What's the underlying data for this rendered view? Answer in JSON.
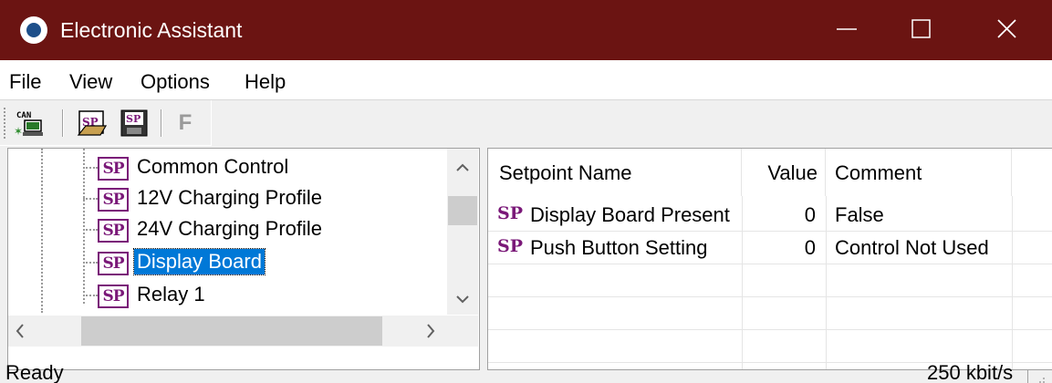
{
  "window": {
    "title": "Electronic Assistant",
    "title_bar_color": "#6b1412",
    "controls": [
      "minimize-icon",
      "maximize-icon",
      "close-icon"
    ]
  },
  "menu": {
    "items": [
      "File",
      "View",
      "Options",
      "Help"
    ]
  },
  "toolbar": {
    "can_label": "CAN",
    "sp_label": "SP",
    "f_label": "F",
    "buttons": [
      "can-connect-icon",
      "sp-open-icon",
      "sp-save-icon",
      "f-icon"
    ]
  },
  "tree": {
    "icon_text": "SP",
    "items": [
      {
        "label": "Common Control",
        "selected": false
      },
      {
        "label": "12V Charging Profile",
        "selected": false
      },
      {
        "label": "24V Charging Profile",
        "selected": false
      },
      {
        "label": "Display Board",
        "selected": true
      },
      {
        "label": "Relay 1",
        "selected": false
      }
    ],
    "selection_color": "#0078d7"
  },
  "list": {
    "columns": [
      "Setpoint Name",
      "Value",
      "Comment"
    ],
    "sp_prefix": "SP",
    "rows": [
      {
        "name": "Display Board Present",
        "value": "0",
        "comment": "False"
      },
      {
        "name": "Push Button Setting",
        "value": "0",
        "comment": "Control Not Used"
      }
    ],
    "sp_color": "#7a1878"
  },
  "status": {
    "text": "Ready",
    "rate": "250 kbit/s"
  }
}
